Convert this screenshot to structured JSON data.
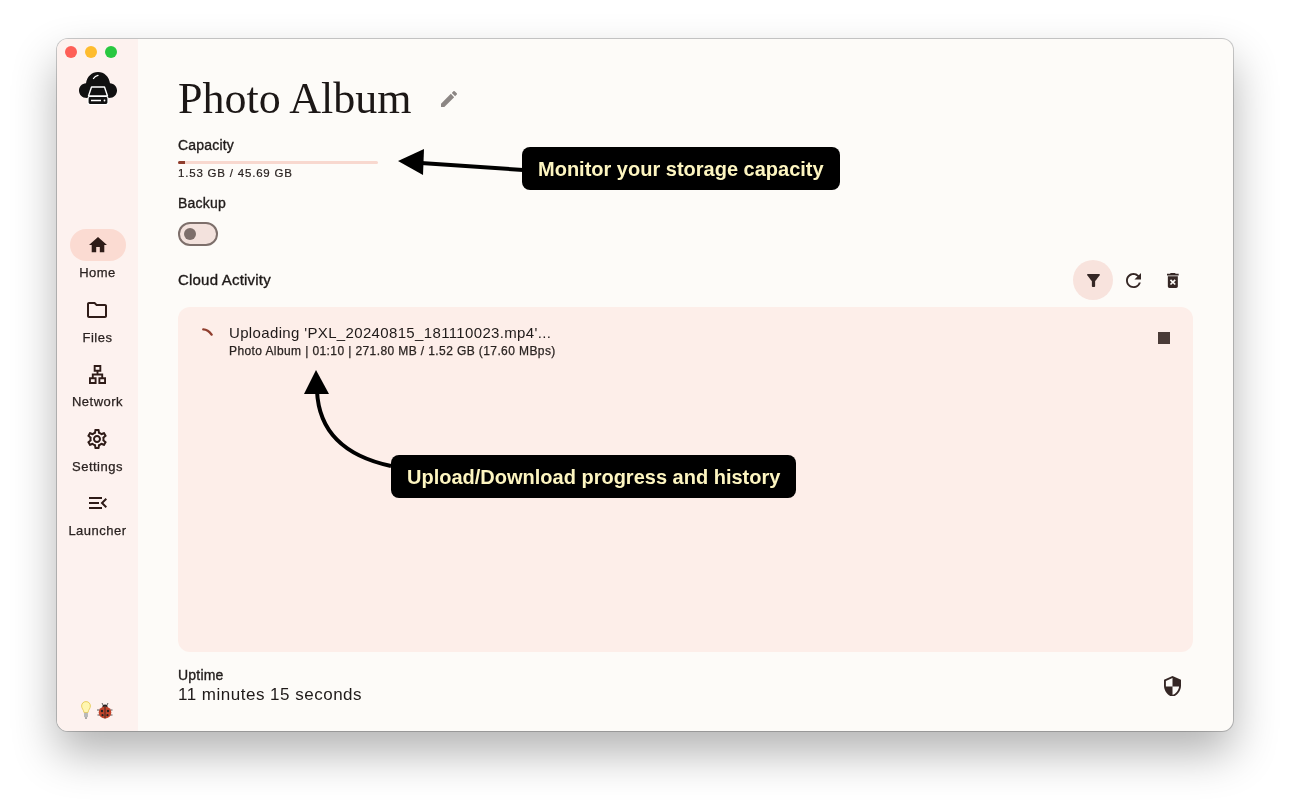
{
  "sidebar": {
    "items": [
      {
        "label": "Home",
        "selected": true
      },
      {
        "label": "Files",
        "selected": false
      },
      {
        "label": "Network",
        "selected": false
      },
      {
        "label": "Settings",
        "selected": false
      },
      {
        "label": "Launcher",
        "selected": false
      }
    ]
  },
  "header": {
    "title": "Photo Album"
  },
  "capacity": {
    "label": "Capacity",
    "level": 0.033,
    "reading": "1.53 GB / 45.69 GB"
  },
  "backup": {
    "label": "Backup",
    "on": false
  },
  "cloud_activity": {
    "title": "Cloud Activity",
    "tools": [
      {
        "kind": "filter",
        "selected": true
      },
      {
        "kind": "refresh",
        "selected": false
      },
      {
        "kind": "clear",
        "selected": false
      }
    ],
    "items": [
      {
        "title": "Uploading 'PXL_20240815_181110023.mp4'...",
        "details": "Photo Album | 01:10 | 271.80 MB / 1.52 GB (17.60 MBps)"
      }
    ]
  },
  "uptime": {
    "label": "Uptime",
    "value": "11 minutes 15 seconds"
  },
  "annotations": [
    {
      "text": "Monitor your storage capacity"
    },
    {
      "text": "Upload/Download progress and history"
    }
  ]
}
